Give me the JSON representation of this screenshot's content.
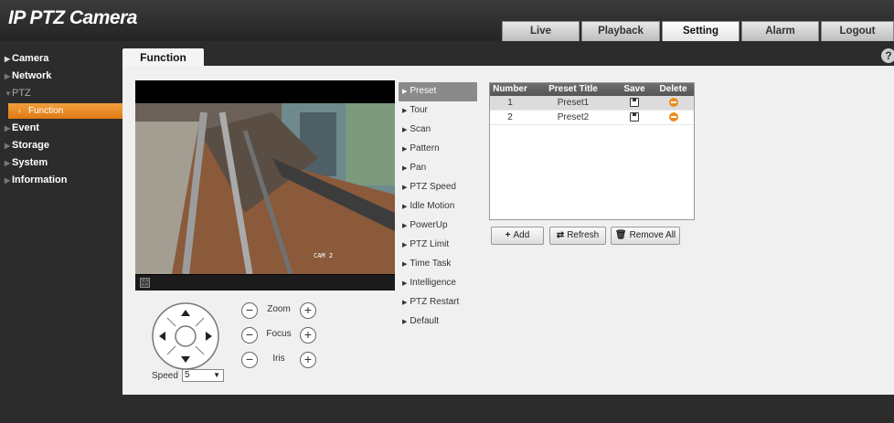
{
  "app": {
    "title": "IP PTZ Camera"
  },
  "nav": {
    "tabs": [
      "Live",
      "Playback",
      "Setting",
      "Alarm",
      "Logout"
    ],
    "active": "Setting"
  },
  "sidebar": {
    "items": [
      {
        "label": "Camera"
      },
      {
        "label": "Network"
      },
      {
        "label": "PTZ"
      },
      {
        "label": "Function"
      },
      {
        "label": "Event"
      },
      {
        "label": "Storage"
      },
      {
        "label": "System"
      },
      {
        "label": "Information"
      }
    ]
  },
  "content": {
    "tab": "Function"
  },
  "video": {
    "overlay_cam": "CAM 2"
  },
  "ptz": {
    "zoom_label": "Zoom",
    "focus_label": "Focus",
    "iris_label": "Iris",
    "speed_label": "Speed",
    "speed_value": "5"
  },
  "functions": {
    "items": [
      "Preset",
      "Tour",
      "Scan",
      "Pattern",
      "Pan",
      "PTZ Speed",
      "Idle Motion",
      "PowerUp",
      "PTZ Limit",
      "Time Task",
      "Intelligence",
      "PTZ Restart",
      "Default"
    ],
    "active": "Preset"
  },
  "preset_table": {
    "headers": {
      "number": "Number",
      "title": "Preset Title",
      "save": "Save",
      "delete": "Delete"
    },
    "rows": [
      {
        "number": "1",
        "title": "Preset1"
      },
      {
        "number": "2",
        "title": "Preset2"
      }
    ]
  },
  "buttons": {
    "add": "Add",
    "refresh": "Refresh",
    "remove_all": "Remove All"
  },
  "colors": {
    "accent": "#e8891f",
    "topbar": "#2f2f2f",
    "panel": "#f0f0f0"
  },
  "icons": {
    "help": "?",
    "add": "+",
    "refresh": "⇄",
    "remove_all": "🗑"
  }
}
